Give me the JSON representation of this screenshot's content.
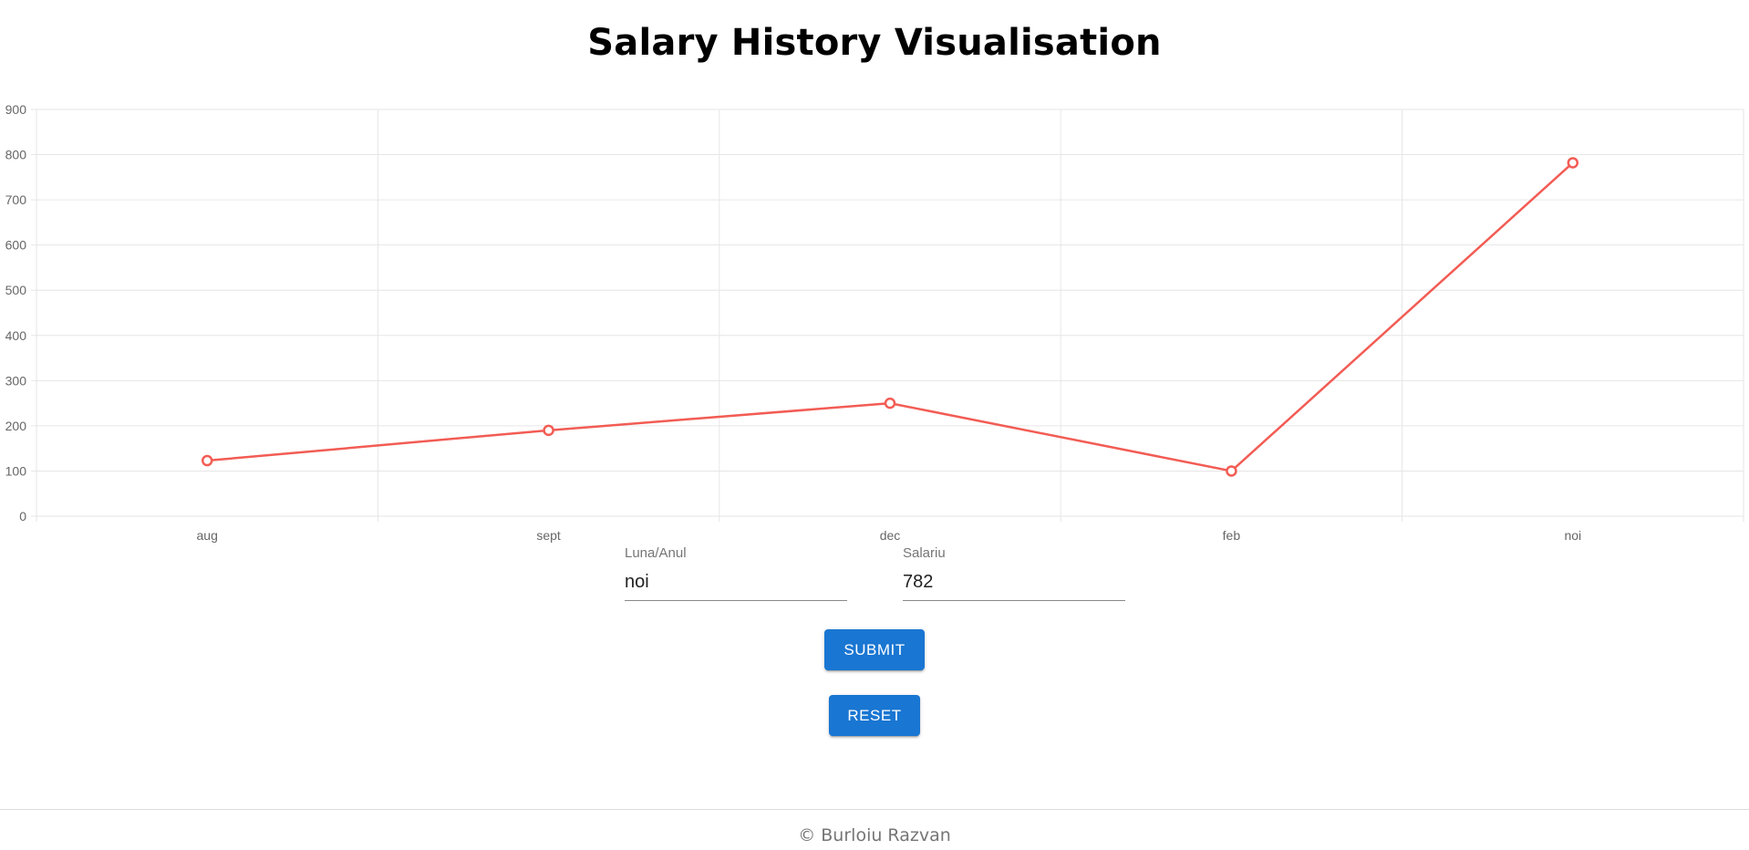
{
  "page": {
    "title": "Salary History Visualisation"
  },
  "chart_data": {
    "type": "line",
    "categories": [
      "aug",
      "sept",
      "dec",
      "feb",
      "noi"
    ],
    "series": [
      {
        "values": [
          123,
          190,
          250,
          100,
          782
        ],
        "color": "#f25c54"
      }
    ],
    "ylim": [
      0,
      900
    ],
    "yticks": [
      0,
      100,
      200,
      300,
      400,
      500,
      600,
      700,
      800,
      900
    ],
    "grid": true,
    "title": "",
    "xlabel": "",
    "ylabel": ""
  },
  "form": {
    "month_label": "Luna/Anul",
    "month_value": "noi",
    "salary_label": "Salariu",
    "salary_value": "782",
    "submit_label": "SUBMIT",
    "reset_label": "RESET"
  },
  "colors": {
    "accent": "#1976d2",
    "line": "#f25c54"
  },
  "footer": {
    "text": "© Burloiu Razvan"
  }
}
